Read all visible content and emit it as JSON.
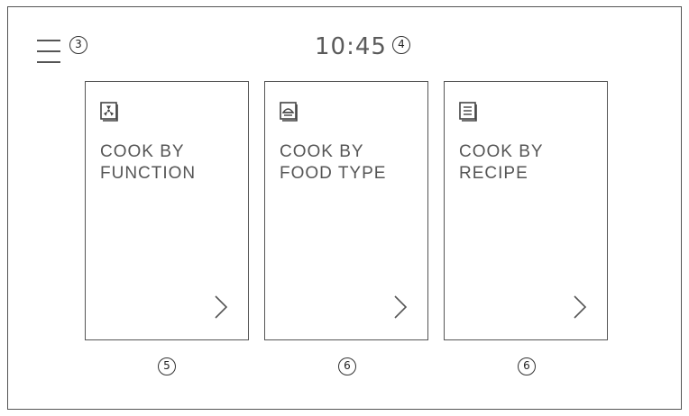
{
  "header": {
    "menu_icon": "hamburger-menu-icon",
    "menu_callout": "3",
    "clock": "10:45",
    "clock_callout": "4"
  },
  "cards": [
    {
      "label": "COOK BY\nFUNCTION",
      "icon": "fan-icon",
      "callout": "5"
    },
    {
      "label": "COOK BY\nFOOD TYPE",
      "icon": "dish-icon",
      "callout": "6"
    },
    {
      "label": "COOK BY\nRECIPE",
      "icon": "recipe-book-icon",
      "callout": "6"
    }
  ]
}
